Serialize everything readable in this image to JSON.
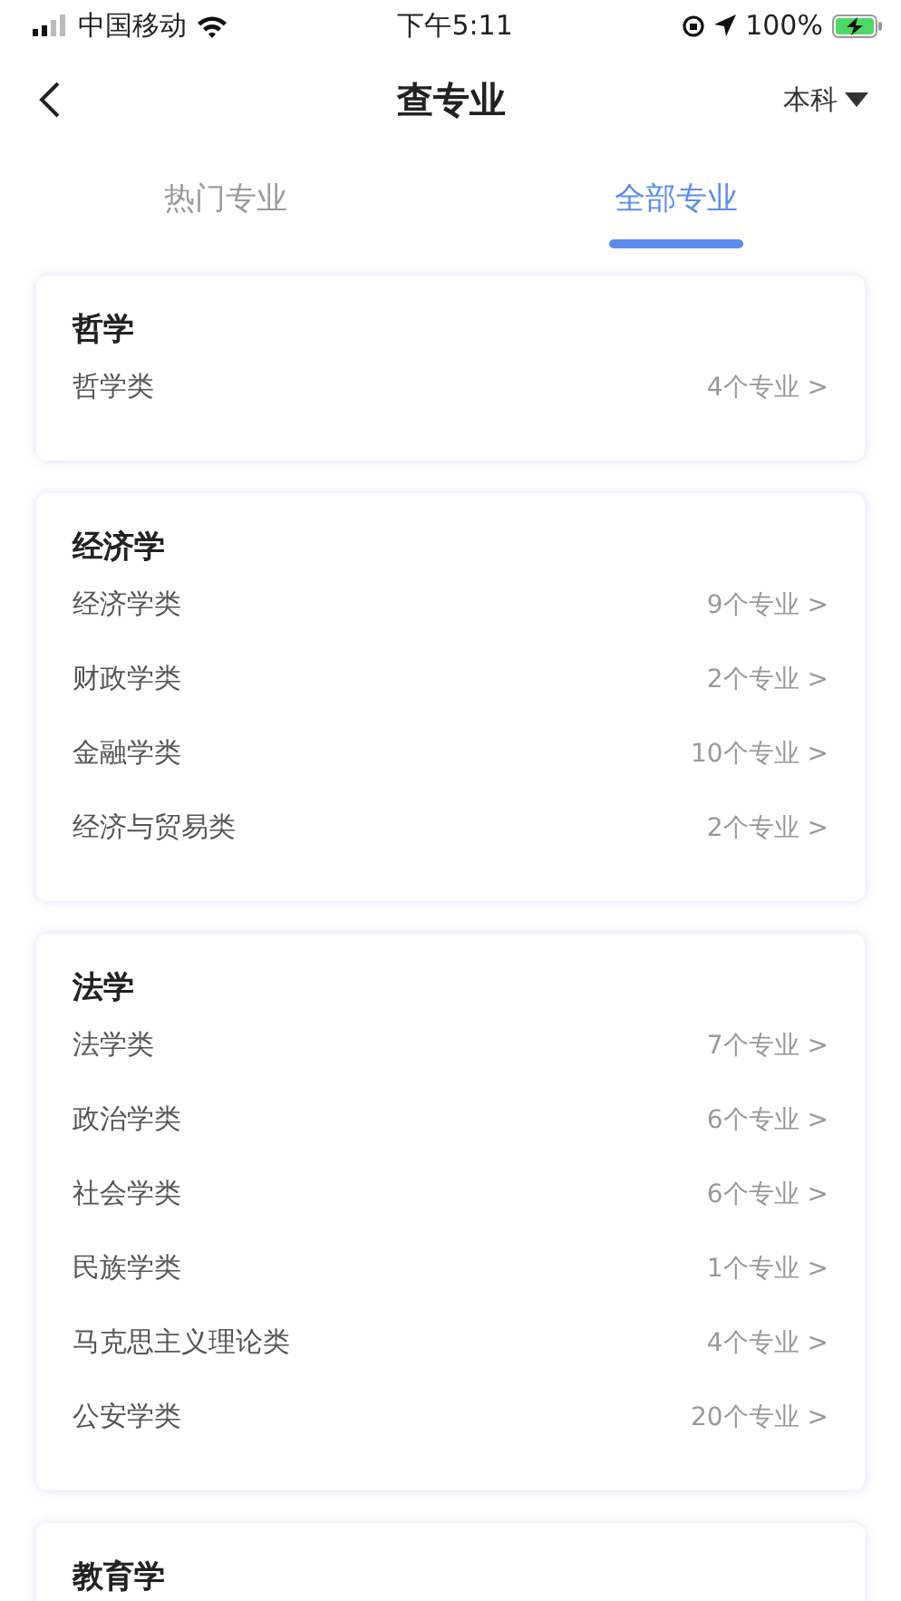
{
  "status_bar": {
    "carrier": "中国移动",
    "time": "下午5:11",
    "battery": "100%"
  },
  "nav": {
    "title": "查专业",
    "level_selector": "本科"
  },
  "tabs": [
    {
      "label": "热门专业",
      "selected": false
    },
    {
      "label": "全部专业",
      "selected": true
    }
  ],
  "categories": [
    {
      "title": "哲学",
      "items": [
        {
          "name": "哲学类",
          "count": "4个专业 >"
        }
      ]
    },
    {
      "title": "经济学",
      "items": [
        {
          "name": "经济学类",
          "count": "9个专业 >"
        },
        {
          "name": "财政学类",
          "count": "2个专业 >"
        },
        {
          "name": "金融学类",
          "count": "10个专业 >"
        },
        {
          "name": "经济与贸易类",
          "count": "2个专业 >"
        }
      ]
    },
    {
      "title": "法学",
      "items": [
        {
          "name": "法学类",
          "count": "7个专业 >"
        },
        {
          "name": "政治学类",
          "count": "6个专业 >"
        },
        {
          "name": "社会学类",
          "count": "6个专业 >"
        },
        {
          "name": "民族学类",
          "count": "1个专业 >"
        },
        {
          "name": "马克思主义理论类",
          "count": "4个专业 >"
        },
        {
          "name": "公安学类",
          "count": "20个专业 >"
        }
      ]
    },
    {
      "title": "教育学"
    }
  ]
}
